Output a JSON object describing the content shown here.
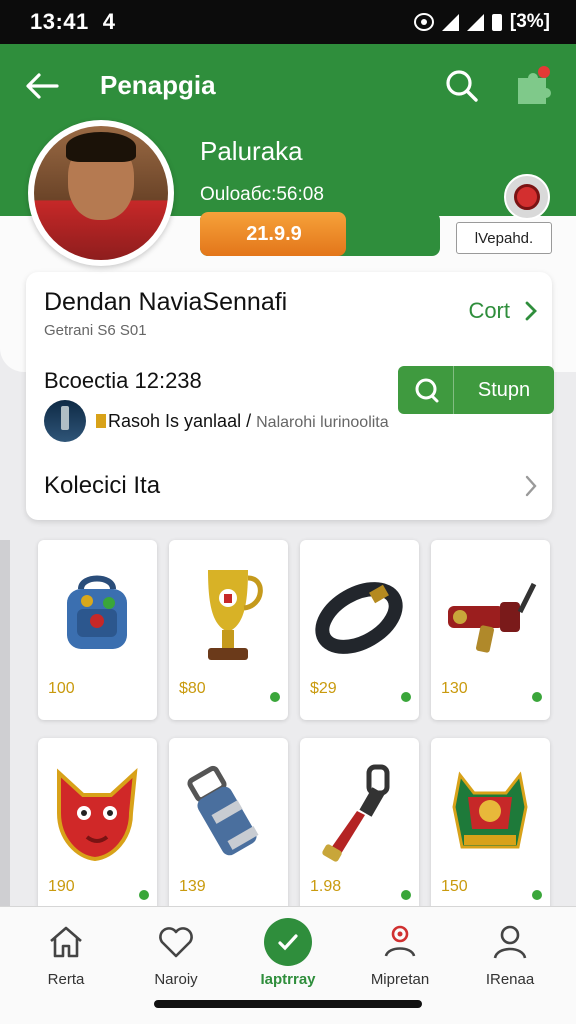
{
  "status_bar": {
    "time": "13:41",
    "indicator": "4",
    "battery": "[3%]"
  },
  "appbar": {
    "title": "Penapgia"
  },
  "profile": {
    "name": "Palurakа",
    "subtitle": "Oulоaбc:56:08",
    "progress_value": "21.9.9",
    "progress_fraction": 0.61,
    "details_label": "lVepahd."
  },
  "info_card": {
    "title": "Dendan NaviaSennafi",
    "subtitle": "Getrani S6 S01",
    "cart_label": "Cort",
    "date": "Bcoectia 12:238",
    "stream_label": "Stupn",
    "channel_name": "Rasoh Is yanlaal",
    "channel_separator": "/",
    "channel_desc": "Nalarohi lurinoolita",
    "collection_label": "Kolecici Ita"
  },
  "items": [
    {
      "price": "100",
      "icon": "backpack-icon"
    },
    {
      "price": "$80",
      "icon": "trophy-icon"
    },
    {
      "price": "$29",
      "icon": "wristband-icon"
    },
    {
      "price": "130",
      "icon": "blaster-icon"
    },
    {
      "price": "190",
      "icon": "fox-mask-icon"
    },
    {
      "price": "139",
      "icon": "bottle-icon"
    },
    {
      "price": "1.98",
      "icon": "torch-icon"
    },
    {
      "price": "150",
      "icon": "crest-icon"
    }
  ],
  "bottom_nav": [
    {
      "label": "Rerta",
      "icon": "home-icon"
    },
    {
      "label": "Naroiy",
      "icon": "heart-icon"
    },
    {
      "label": "Iaptrray",
      "icon": "check-icon",
      "active": true
    },
    {
      "label": "Mipretan",
      "icon": "badge-user-icon"
    },
    {
      "label": "IRenaa",
      "icon": "profile-icon"
    }
  ],
  "colors": {
    "primary": "#2f8e3c",
    "progress": "#e3761a",
    "price": "#c99a0e",
    "notification": "#e53935"
  }
}
